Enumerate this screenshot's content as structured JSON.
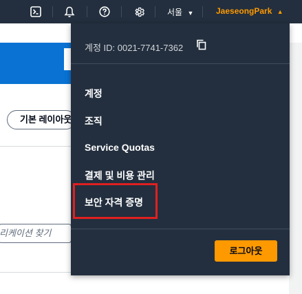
{
  "topbar": {
    "region_label": "서울",
    "account_name": "JaeseongPark",
    "icons": [
      "cloudshell-icon",
      "bell-icon",
      "help-icon",
      "gear-icon"
    ]
  },
  "background": {
    "layout_button_label": "기본 레이아웃",
    "search_placeholder": "리케이션 찾기"
  },
  "dropdown": {
    "account_id_label": "계정 ID: 0021-7741-7362",
    "items": [
      {
        "label": "계정"
      },
      {
        "label": "조직"
      },
      {
        "label": "Service Quotas"
      },
      {
        "label": "결제 및 비용 관리"
      },
      {
        "label": "보안 자격 증명"
      }
    ],
    "logout_label": "로그아웃"
  },
  "colors": {
    "nav_bg": "#232f3e",
    "accent_orange": "#ff9900",
    "highlight_red": "#e02020",
    "brand_blue": "#0972d3"
  }
}
